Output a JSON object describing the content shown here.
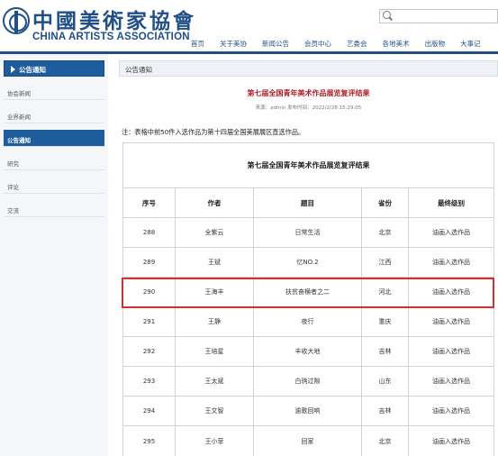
{
  "header": {
    "logo_cn": "中國美術家協會",
    "logo_en": "CHINA ARTISTS ASSOCIATION",
    "nav": [
      "首页",
      "关于美协",
      "新闻公告",
      "会员中心",
      "艺委会",
      "各地美术",
      "出版物",
      "大事记"
    ]
  },
  "sidebar": {
    "title": "公告通知",
    "items": [
      {
        "label": "协会新闻",
        "active": false
      },
      {
        "label": "业界新闻",
        "active": false
      },
      {
        "label": "公告通知",
        "active": true
      },
      {
        "label": "研究",
        "active": false
      },
      {
        "label": "评论",
        "active": false
      },
      {
        "label": "交流",
        "active": false
      }
    ]
  },
  "main": {
    "panel_title": "公告通知",
    "article_title": "第七届全国青年美术作品展览复评结果",
    "article_meta": "来源：admin 发布时间：2022/2/28 15:29:05",
    "note": "注：表格中前50件入选作品为第十四届全国美展展区直选作品。",
    "table": {
      "caption": "第七届全国青年美术作品展览复评结果",
      "headers": [
        "序号",
        "作者",
        "题目",
        "省份",
        "最终级别"
      ],
      "rows": [
        [
          "288",
          "全紫云",
          "日常生活",
          "北京",
          "油画入选作品"
        ],
        [
          "289",
          "王斌",
          "忆NO.2",
          "江西",
          "油画入选作品"
        ],
        [
          "290",
          "王海丰",
          "扶贫奋横者之二",
          "河北",
          "油画入选作品"
        ],
        [
          "291",
          "王静",
          "夜行",
          "重庆",
          "油画入选作品"
        ],
        [
          "292",
          "王培星",
          "丰收大地",
          "吉林",
          "油画入选作品"
        ],
        [
          "293",
          "王太斌",
          "白驹过隙",
          "山东",
          "油画入选作品"
        ],
        [
          "294",
          "王文智",
          "逾歌回响",
          "吉林",
          "油画入选作品"
        ],
        [
          "295",
          "王小菲",
          "回家",
          "北京",
          "油画入选作品"
        ]
      ],
      "highlighted_row": "290"
    }
  },
  "colors": {
    "brand": "#1f4f86",
    "title_red": "#b3202a",
    "highlight": "#d0312d"
  }
}
